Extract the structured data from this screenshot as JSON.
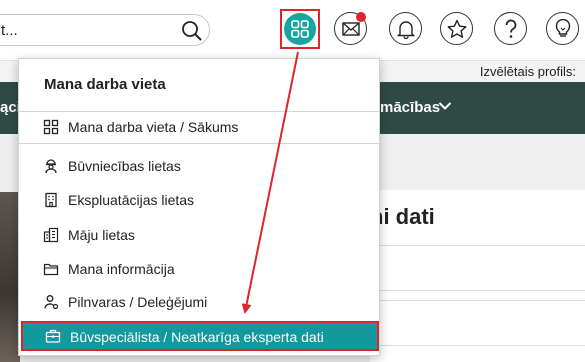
{
  "search": {
    "value": "t..."
  },
  "header": {
    "icons": [
      "search-icon",
      "apps-grid-icon",
      "mail-icon",
      "bell-icon",
      "star-icon",
      "help-icon",
      "lightbulb-icon"
    ],
    "accent_color": "#14a6a1",
    "highlight_color": "#e0242c",
    "profile_label": "Izvēlētais profils:"
  },
  "nav": {
    "left_fragment": "ącij",
    "item_fragment": "mācības"
  },
  "main": {
    "card_title": "ni dati"
  },
  "menu": {
    "title": "Mana darba vieta",
    "items": [
      {
        "label": "Mana darba vieta / Sākums",
        "icon": "grid-icon"
      },
      {
        "label": "Būvniecības lietas",
        "icon": "worker-icon"
      },
      {
        "label": "Ekspluatācijas lietas",
        "icon": "building-icon"
      },
      {
        "label": "Māju lietas",
        "icon": "apartment-icon"
      },
      {
        "label": "Mana informācija",
        "icon": "folder-icon"
      },
      {
        "label": "Pilnvaras / Deleģējumi",
        "icon": "person-share-icon"
      },
      {
        "label": "Būvspeciālista / Neatkarīga eksperta dati",
        "icon": "briefcase-icon",
        "active": true
      }
    ]
  }
}
